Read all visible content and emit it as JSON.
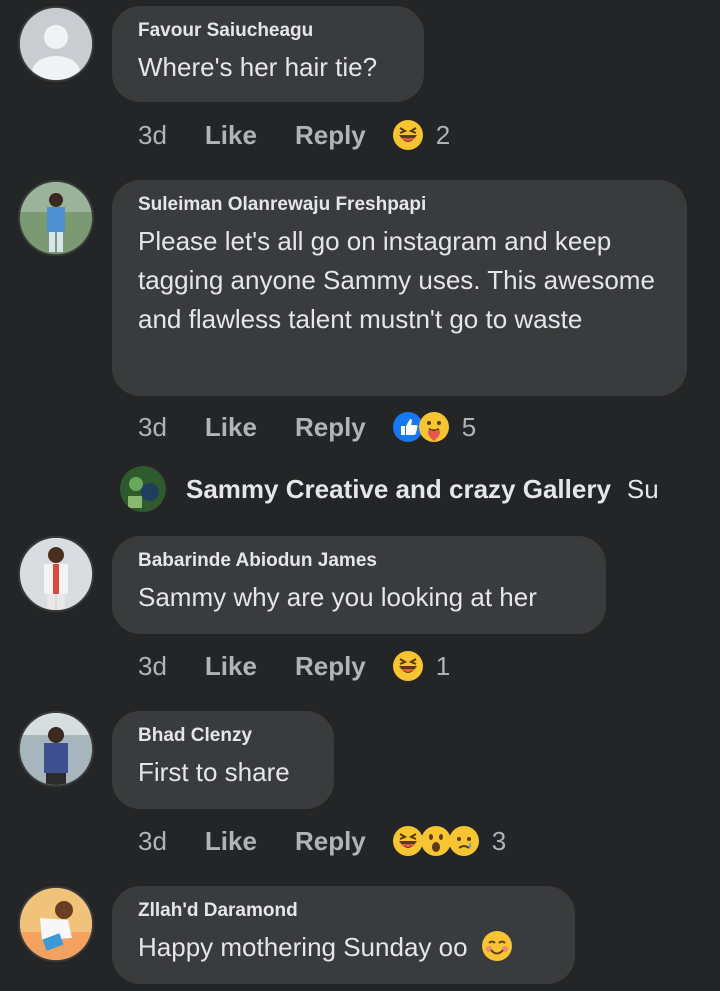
{
  "comments": [
    {
      "author": "Favour Saiucheagu",
      "text": "Where's her hair tie?",
      "time": "3d",
      "like_label": "Like",
      "reply_label": "Reply",
      "reactions": [
        "haha-icon"
      ],
      "reaction_count": "2"
    },
    {
      "author": "Suleiman Olanrewaju Freshpapi",
      "text": "Please let's all go on instagram and keep tagging anyone Sammy uses. This awesome and flawless talent mustn't go to waste",
      "time": "3d",
      "like_label": "Like",
      "reply_label": "Reply",
      "reactions": [
        "like-icon",
        "care-icon"
      ],
      "reaction_count": "5"
    },
    {
      "author": "Babarinde Abiodun James",
      "text": "Sammy why are you looking at her",
      "time": "3d",
      "like_label": "Like",
      "reply_label": "Reply",
      "reactions": [
        "haha-icon"
      ],
      "reaction_count": "1"
    },
    {
      "author": "Bhad Clenzy",
      "text": "First to share",
      "time": "3d",
      "like_label": "Like",
      "reply_label": "Reply",
      "reactions": [
        "haha-icon",
        "wow-icon",
        "sad-icon"
      ],
      "reaction_count": "3"
    },
    {
      "author": "Zllah'd Daramond",
      "text": "Happy mothering Sunday oo",
      "emoji": "blush-emoji-icon"
    }
  ],
  "reply_preview": {
    "author": "Sammy Creative and crazy Gallery",
    "text": "Su"
  },
  "colors": {
    "background": "#242526",
    "bubble": "#3a3b3c",
    "text_primary": "#e4e6eb",
    "text_secondary": "#b0b3b8",
    "like_blue": "#1877f2",
    "emoji_yellow": "#f7c531"
  }
}
